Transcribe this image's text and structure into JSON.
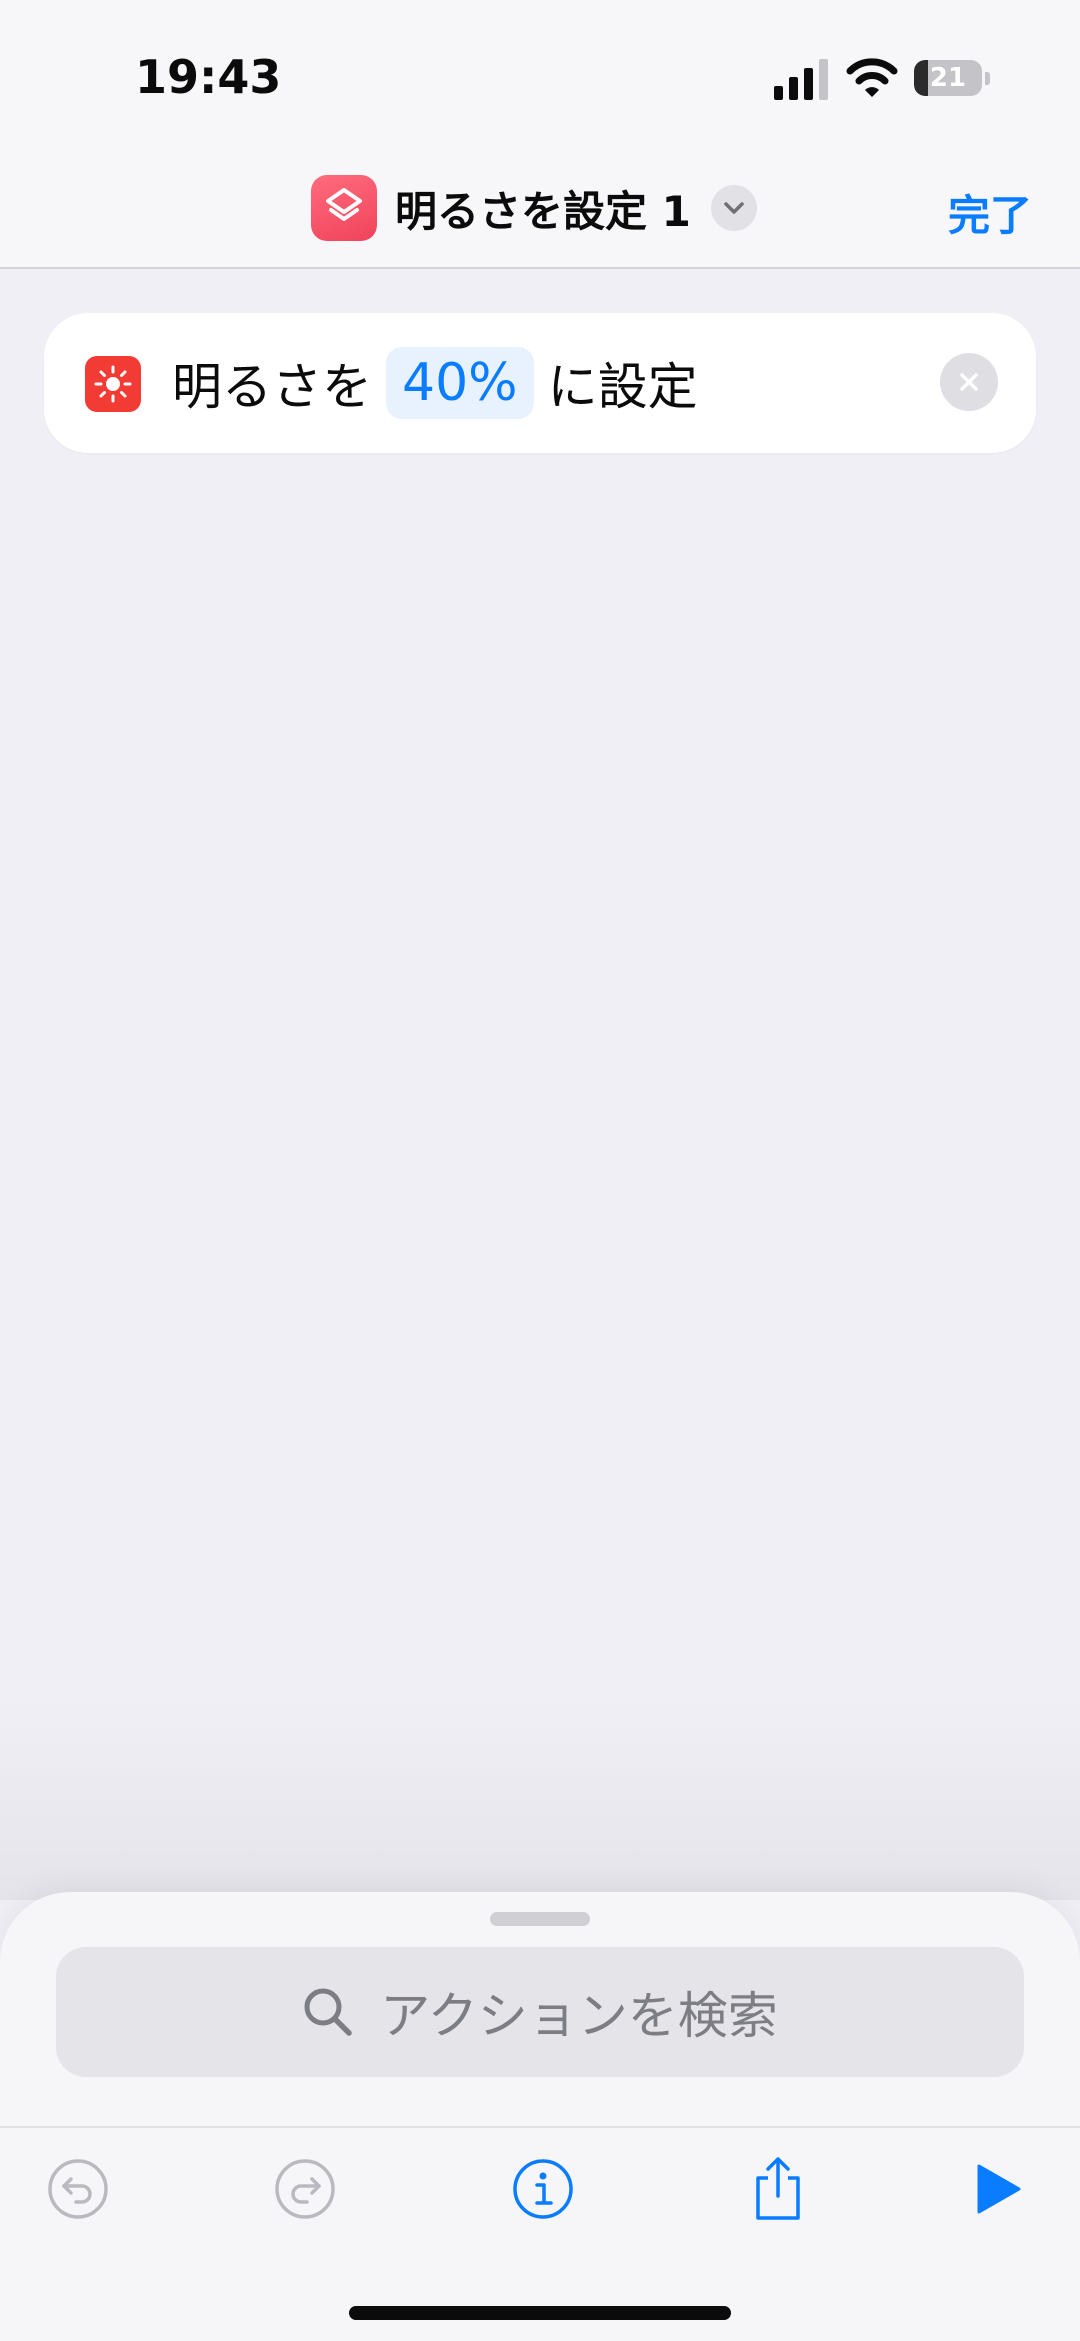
{
  "status_bar": {
    "time": "19:43",
    "battery_level": "21",
    "battery_fraction": 0.21,
    "icons": [
      "signal-icon",
      "wifi-icon",
      "battery-icon"
    ]
  },
  "nav": {
    "title": "明るさを設定 1",
    "done_label": "完了",
    "icons": [
      "shortcuts-app-icon",
      "chevron-down-icon"
    ]
  },
  "action": {
    "prefix": "明るさを",
    "parameter": "40%",
    "suffix": "に設定",
    "icons": [
      "brightness-icon",
      "remove-icon"
    ]
  },
  "search": {
    "placeholder": "アクションを検索",
    "icon": "search-icon"
  },
  "toolbar": {
    "icons": [
      "undo-icon",
      "redo-icon",
      "info-icon",
      "share-icon",
      "play-icon"
    ]
  },
  "colors": {
    "accent": "#0a7cff",
    "action_icon": "#f23b35",
    "app_icon": "#f0435b",
    "background": "#efeff5"
  }
}
